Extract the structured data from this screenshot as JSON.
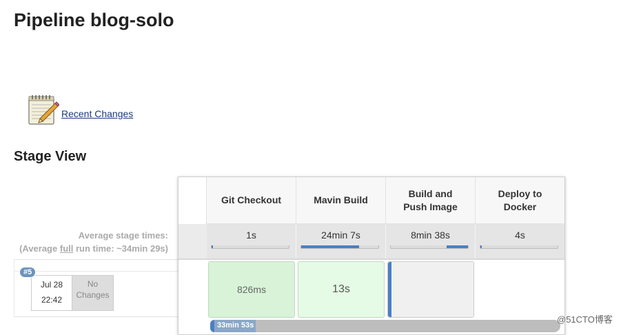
{
  "page": {
    "title": "Pipeline blog-solo"
  },
  "recent_changes": {
    "label": "Recent Changes",
    "icon": "notepad-pencil-icon"
  },
  "stage_view": {
    "title": "Stage View",
    "average_label": "Average stage times:",
    "average_full_prefix": "(Average ",
    "average_full_word": "full",
    "average_full_suffix": " run time: ~34min 29s)",
    "stages": [
      {
        "name_line1": "Git Checkout",
        "name_line2": "",
        "avg": "1s",
        "avg_fraction": 0.01
      },
      {
        "name_line1": "Mavin Build",
        "name_line2": "",
        "avg": "24min 7s",
        "avg_fraction": 0.74
      },
      {
        "name_line1": "Build and",
        "name_line2": "Push Image",
        "avg": "8min 38s",
        "avg_fraction": 0.27
      },
      {
        "name_line1": "Deploy to",
        "name_line2": "Docker",
        "avg": "4s",
        "avg_fraction": 0.01
      }
    ],
    "build": {
      "number": "#5",
      "date": "Jul 28",
      "time": "22:42",
      "changes_line1": "No",
      "changes_line2": "Changes",
      "stage_times": [
        "826ms",
        "13s",
        "",
        ""
      ],
      "total_time": "33min 53s"
    }
  },
  "colors": {
    "success_green": "#dff5df",
    "running_blue": "#4a7fc4",
    "badge_blue": "#6d93bd"
  },
  "watermark": "@51CTO博客"
}
